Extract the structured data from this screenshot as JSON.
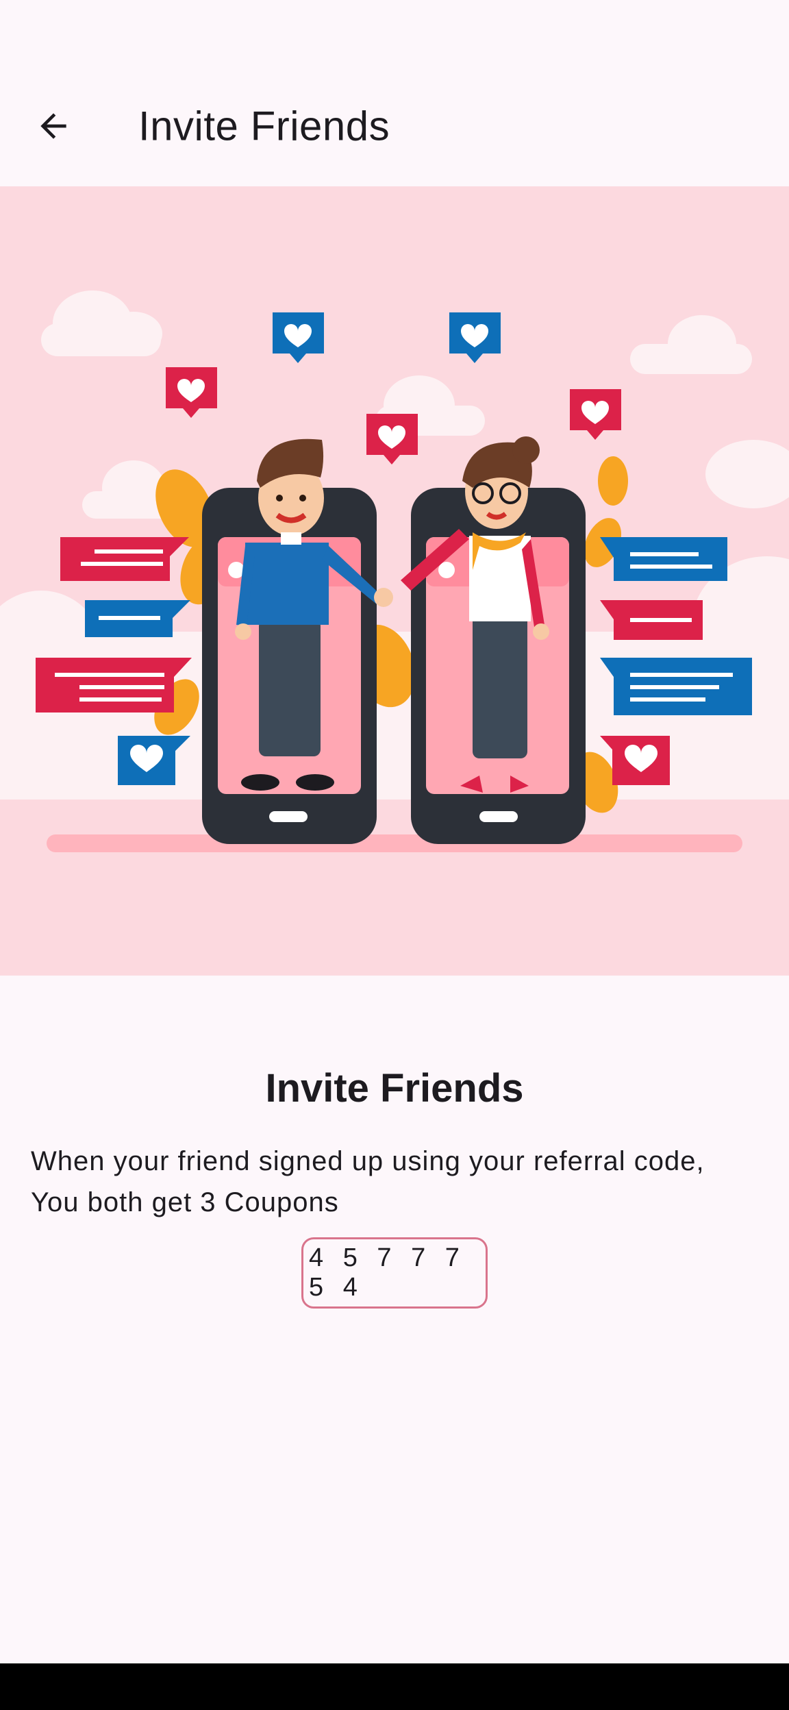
{
  "app_bar": {
    "title": "Invite Friends",
    "back_icon": "arrow-back-icon"
  },
  "hero": {
    "illustration": "couple-holding-hands-phones-illustration"
  },
  "content": {
    "title": "Invite Friends",
    "description_line1": "When your friend signed up using your referral code,",
    "description_line2": "You both get 3 Coupons",
    "referral_code": "4 5 7 7 7 5 4"
  },
  "colors": {
    "background": "#fdf7fb",
    "hero_background": "#fcd9df",
    "accent_red": "#dc2249",
    "accent_blue": "#0e6fb8",
    "code_border": "#d9748c",
    "nav_bar": "#000000"
  }
}
